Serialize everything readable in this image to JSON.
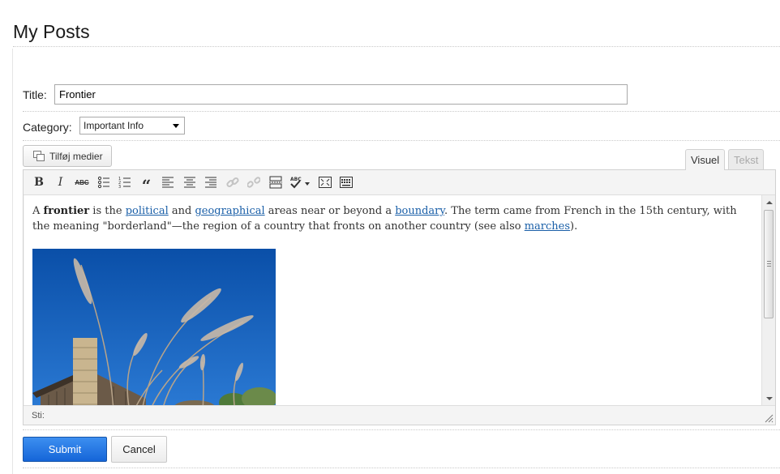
{
  "page": {
    "title": "My Posts"
  },
  "form": {
    "title_label": "Title:",
    "title_value": "Frontier",
    "category_label": "Category:",
    "category_value": "Important Info"
  },
  "editor": {
    "add_media_label": "Tilføj medier",
    "tabs": {
      "visual": "Visuel",
      "text": "Tekst"
    },
    "active_tab": "visual",
    "toolbar": [
      {
        "name": "bold",
        "glyph": "B",
        "enabled": true
      },
      {
        "name": "italic",
        "glyph": "I",
        "enabled": true
      },
      {
        "name": "strikethrough",
        "glyph": "ABC",
        "enabled": true
      },
      {
        "name": "bullet-list",
        "enabled": true
      },
      {
        "name": "numbered-list",
        "enabled": true
      },
      {
        "name": "blockquote",
        "glyph": "“",
        "enabled": true
      },
      {
        "name": "align-left",
        "enabled": true
      },
      {
        "name": "align-center",
        "enabled": true
      },
      {
        "name": "align-right",
        "enabled": true
      },
      {
        "name": "insert-link",
        "enabled": false
      },
      {
        "name": "remove-link",
        "enabled": false
      },
      {
        "name": "read-more",
        "enabled": true
      },
      {
        "name": "spellcheck",
        "glyph": "ABC",
        "enabled": true
      },
      {
        "name": "fullscreen",
        "enabled": true
      },
      {
        "name": "kitchen-sink",
        "enabled": true
      }
    ],
    "content": {
      "p1_before": "A ",
      "p1_bold": "frontier",
      "p1_t1": " is the ",
      "link_political": "political",
      "p1_t2": " and ",
      "link_geographical": "geographical",
      "p1_t3": " areas near or beyond a ",
      "link_boundary": "boundary",
      "p1_t4": ". The term came from French in the 15th century, with the meaning \"borderland\"—the region of a country that fronts on another country (see also ",
      "link_marches": "marches",
      "p1_t5": ")."
    },
    "status_path_label": "Sti:"
  },
  "actions": {
    "submit_label": "Submit",
    "cancel_label": "Cancel"
  },
  "colors": {
    "primary": "#1a6ee0",
    "link": "#1a5fa8",
    "sky": "#1560b8"
  }
}
